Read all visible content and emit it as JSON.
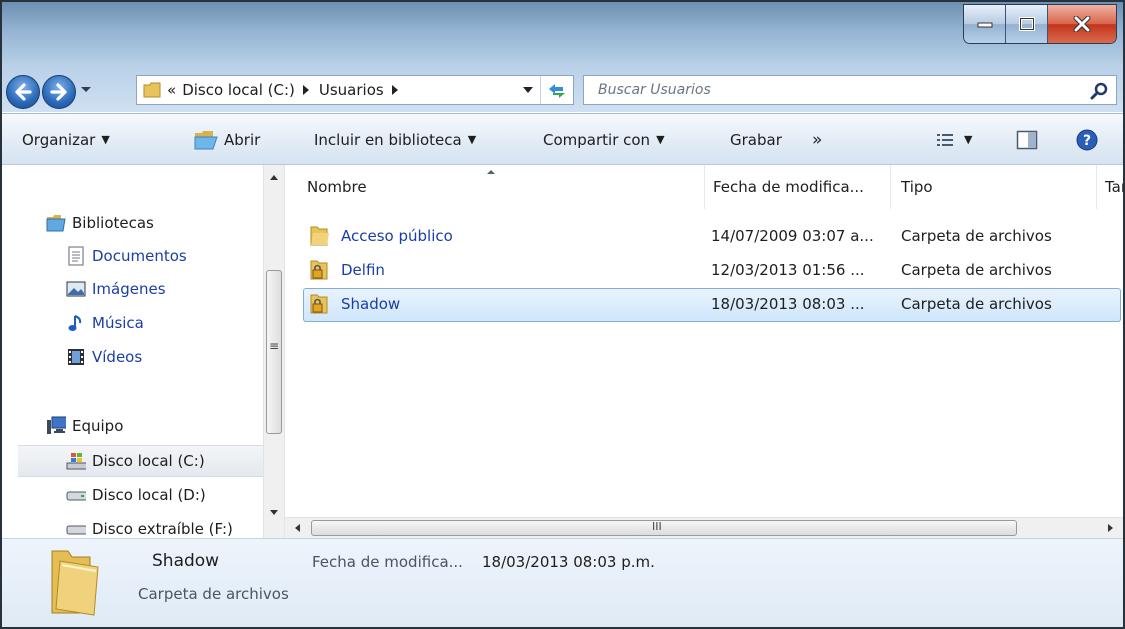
{
  "address": {
    "overflow": "«",
    "segments": [
      "Disco local (C:)",
      "Usuarios"
    ],
    "search_placeholder": "Buscar Usuarios"
  },
  "toolbar": {
    "organize": "Organizar",
    "open": "Abrir",
    "include": "Incluir en biblioteca",
    "share": "Compartir con",
    "burn": "Grabar",
    "more": "»"
  },
  "navpane": {
    "libraries": "Bibliotecas",
    "documents": "Documentos",
    "images": "Imágenes",
    "music": "Música",
    "videos": "Vídeos",
    "computer": "Equipo",
    "drive_c": "Disco local (C:)",
    "drive_d": "Disco local (D:)",
    "drive_f": "Disco extraíble (F:)"
  },
  "columns": {
    "name": "Nombre",
    "date": "Fecha de modifica...",
    "type": "Tipo",
    "size": "Tam"
  },
  "files": [
    {
      "name": "Acceso público",
      "date": "14/07/2009 03:07 a...",
      "type": "Carpeta de archivos"
    },
    {
      "name": "Delfin",
      "date": "12/03/2013 01:56 ...",
      "type": "Carpeta de archivos"
    },
    {
      "name": "Shadow",
      "date": "18/03/2013 08:03 ...",
      "type": "Carpeta de archivos"
    }
  ],
  "details": {
    "name": "Shadow",
    "type": "Carpeta de archivos",
    "date_label": "Fecha de modifica...",
    "date_value": "18/03/2013 08:03 p.m."
  },
  "scroll": {
    "h_arrow_label": "III",
    "v_grip": "≡"
  }
}
